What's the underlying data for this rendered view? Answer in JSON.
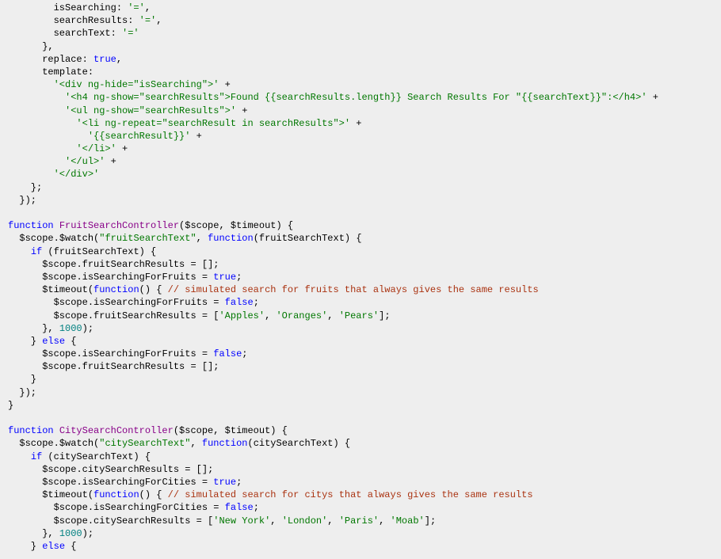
{
  "code": {
    "lines": [
      [
        [
          "        ",
          "punct"
        ],
        [
          "isSearching",
          "propkey"
        ],
        [
          ":",
          "punct"
        ],
        [
          " ",
          "default"
        ],
        [
          "'='",
          "string"
        ],
        [
          ",",
          "punct"
        ]
      ],
      [
        [
          "        ",
          "punct"
        ],
        [
          "searchResults",
          "propkey"
        ],
        [
          ":",
          "punct"
        ],
        [
          " ",
          "default"
        ],
        [
          "'='",
          "string"
        ],
        [
          ",",
          "punct"
        ]
      ],
      [
        [
          "        ",
          "punct"
        ],
        [
          "searchText",
          "propkey"
        ],
        [
          ":",
          "punct"
        ],
        [
          " ",
          "default"
        ],
        [
          "'='",
          "string"
        ]
      ],
      [
        [
          "      },",
          "punct"
        ]
      ],
      [
        [
          "      ",
          "punct"
        ],
        [
          "replace",
          "propkey"
        ],
        [
          ":",
          "punct"
        ],
        [
          " ",
          "default"
        ],
        [
          "true",
          "bool"
        ],
        [
          ",",
          "punct"
        ]
      ],
      [
        [
          "      ",
          "punct"
        ],
        [
          "template",
          "propkey"
        ],
        [
          ":",
          "punct"
        ]
      ],
      [
        [
          "        ",
          "punct"
        ],
        [
          "'<div ng-hide=\"isSearching\">'",
          "string"
        ],
        [
          " + ",
          "op"
        ]
      ],
      [
        [
          "          ",
          "punct"
        ],
        [
          "'<h4 ng-show=\"searchResults\">Found {{searchResults.length}} Search Results For \"{{searchText}}\":</h4>'",
          "string"
        ],
        [
          " + ",
          "op"
        ]
      ],
      [
        [
          "          ",
          "punct"
        ],
        [
          "'<ul ng-show=\"searchResults\">'",
          "string"
        ],
        [
          " + ",
          "op"
        ]
      ],
      [
        [
          "            ",
          "punct"
        ],
        [
          "'<li ng-repeat=\"searchResult in searchResults\">'",
          "string"
        ],
        [
          " + ",
          "op"
        ]
      ],
      [
        [
          "              ",
          "punct"
        ],
        [
          "'{{searchResult}}'",
          "string"
        ],
        [
          " + ",
          "op"
        ]
      ],
      [
        [
          "            ",
          "punct"
        ],
        [
          "'</li>'",
          "string"
        ],
        [
          " + ",
          "op"
        ]
      ],
      [
        [
          "          ",
          "punct"
        ],
        [
          "'</ul>'",
          "string"
        ],
        [
          " + ",
          "op"
        ]
      ],
      [
        [
          "        ",
          "punct"
        ],
        [
          "'</div>'",
          "string"
        ]
      ],
      [
        [
          "    };",
          "punct"
        ]
      ],
      [
        [
          "  });",
          "punct"
        ]
      ],
      [
        [
          "",
          "default"
        ]
      ],
      [
        [
          "function",
          "kw"
        ],
        [
          " ",
          "default"
        ],
        [
          "FruitSearchController",
          "func"
        ],
        [
          "(",
          "punct"
        ],
        [
          "$scope",
          "var"
        ],
        [
          ", ",
          "punct"
        ],
        [
          "$timeout",
          "var"
        ],
        [
          ") {",
          "punct"
        ]
      ],
      [
        [
          "  ",
          "punct"
        ],
        [
          "$scope",
          "var"
        ],
        [
          ".",
          "punct"
        ],
        [
          "$watch",
          "var"
        ],
        [
          "(",
          "punct"
        ],
        [
          "\"fruitSearchText\"",
          "string"
        ],
        [
          ", ",
          "punct"
        ],
        [
          "function",
          "kw"
        ],
        [
          "(",
          "punct"
        ],
        [
          "fruitSearchText",
          "var"
        ],
        [
          ") {",
          "punct"
        ]
      ],
      [
        [
          "    ",
          "punct"
        ],
        [
          "if",
          "kw"
        ],
        [
          " (",
          "punct"
        ],
        [
          "fruitSearchText",
          "var"
        ],
        [
          ") {",
          "punct"
        ]
      ],
      [
        [
          "      ",
          "punct"
        ],
        [
          "$scope",
          "var"
        ],
        [
          ".",
          "punct"
        ],
        [
          "fruitSearchResults",
          "var"
        ],
        [
          " = [];",
          "punct"
        ]
      ],
      [
        [
          "      ",
          "punct"
        ],
        [
          "$scope",
          "var"
        ],
        [
          ".",
          "punct"
        ],
        [
          "isSearchingForFruits",
          "var"
        ],
        [
          " = ",
          "op"
        ],
        [
          "true",
          "bool"
        ],
        [
          ";",
          "punct"
        ]
      ],
      [
        [
          "      ",
          "punct"
        ],
        [
          "$timeout",
          "var"
        ],
        [
          "(",
          "punct"
        ],
        [
          "function",
          "kw"
        ],
        [
          "() { ",
          "punct"
        ],
        [
          "// simulated search for fruits that always gives the same results",
          "comment"
        ]
      ],
      [
        [
          "        ",
          "punct"
        ],
        [
          "$scope",
          "var"
        ],
        [
          ".",
          "punct"
        ],
        [
          "isSearchingForFruits",
          "var"
        ],
        [
          " = ",
          "op"
        ],
        [
          "false",
          "bool"
        ],
        [
          ";",
          "punct"
        ]
      ],
      [
        [
          "        ",
          "punct"
        ],
        [
          "$scope",
          "var"
        ],
        [
          ".",
          "punct"
        ],
        [
          "fruitSearchResults",
          "var"
        ],
        [
          " = [",
          "punct"
        ],
        [
          "'Apples'",
          "string"
        ],
        [
          ", ",
          "punct"
        ],
        [
          "'Oranges'",
          "string"
        ],
        [
          ", ",
          "punct"
        ],
        [
          "'Pears'",
          "string"
        ],
        [
          "];",
          "punct"
        ]
      ],
      [
        [
          "      }, ",
          "punct"
        ],
        [
          "1000",
          "number"
        ],
        [
          ");",
          "punct"
        ]
      ],
      [
        [
          "    } ",
          "punct"
        ],
        [
          "else",
          "kw"
        ],
        [
          " {",
          "punct"
        ]
      ],
      [
        [
          "      ",
          "punct"
        ],
        [
          "$scope",
          "var"
        ],
        [
          ".",
          "punct"
        ],
        [
          "isSearchingForFruits",
          "var"
        ],
        [
          " = ",
          "op"
        ],
        [
          "false",
          "bool"
        ],
        [
          ";",
          "punct"
        ]
      ],
      [
        [
          "      ",
          "punct"
        ],
        [
          "$scope",
          "var"
        ],
        [
          ".",
          "punct"
        ],
        [
          "fruitSearchResults",
          "var"
        ],
        [
          " = [];",
          "punct"
        ]
      ],
      [
        [
          "    }",
          "punct"
        ]
      ],
      [
        [
          "  });",
          "punct"
        ]
      ],
      [
        [
          "}",
          "punct"
        ]
      ],
      [
        [
          "",
          "default"
        ]
      ],
      [
        [
          "function",
          "kw"
        ],
        [
          " ",
          "default"
        ],
        [
          "CitySearchController",
          "func"
        ],
        [
          "(",
          "punct"
        ],
        [
          "$scope",
          "var"
        ],
        [
          ", ",
          "punct"
        ],
        [
          "$timeout",
          "var"
        ],
        [
          ") {",
          "punct"
        ]
      ],
      [
        [
          "  ",
          "punct"
        ],
        [
          "$scope",
          "var"
        ],
        [
          ".",
          "punct"
        ],
        [
          "$watch",
          "var"
        ],
        [
          "(",
          "punct"
        ],
        [
          "\"citySearchText\"",
          "string"
        ],
        [
          ", ",
          "punct"
        ],
        [
          "function",
          "kw"
        ],
        [
          "(",
          "punct"
        ],
        [
          "citySearchText",
          "var"
        ],
        [
          ") {",
          "punct"
        ]
      ],
      [
        [
          "    ",
          "punct"
        ],
        [
          "if",
          "kw"
        ],
        [
          " (",
          "punct"
        ],
        [
          "citySearchText",
          "var"
        ],
        [
          ") {",
          "punct"
        ]
      ],
      [
        [
          "      ",
          "punct"
        ],
        [
          "$scope",
          "var"
        ],
        [
          ".",
          "punct"
        ],
        [
          "citySearchResults",
          "var"
        ],
        [
          " = [];",
          "punct"
        ]
      ],
      [
        [
          "      ",
          "punct"
        ],
        [
          "$scope",
          "var"
        ],
        [
          ".",
          "punct"
        ],
        [
          "isSearchingForCities",
          "var"
        ],
        [
          " = ",
          "op"
        ],
        [
          "true",
          "bool"
        ],
        [
          ";",
          "punct"
        ]
      ],
      [
        [
          "      ",
          "punct"
        ],
        [
          "$timeout",
          "var"
        ],
        [
          "(",
          "punct"
        ],
        [
          "function",
          "kw"
        ],
        [
          "() { ",
          "punct"
        ],
        [
          "// simulated search for citys that always gives the same results",
          "comment"
        ]
      ],
      [
        [
          "        ",
          "punct"
        ],
        [
          "$scope",
          "var"
        ],
        [
          ".",
          "punct"
        ],
        [
          "isSearchingForCities",
          "var"
        ],
        [
          " = ",
          "op"
        ],
        [
          "false",
          "bool"
        ],
        [
          ";",
          "punct"
        ]
      ],
      [
        [
          "        ",
          "punct"
        ],
        [
          "$scope",
          "var"
        ],
        [
          ".",
          "punct"
        ],
        [
          "citySearchResults",
          "var"
        ],
        [
          " = [",
          "punct"
        ],
        [
          "'New York'",
          "string"
        ],
        [
          ", ",
          "punct"
        ],
        [
          "'London'",
          "string"
        ],
        [
          ", ",
          "punct"
        ],
        [
          "'Paris'",
          "string"
        ],
        [
          ", ",
          "punct"
        ],
        [
          "'Moab'",
          "string"
        ],
        [
          "];",
          "punct"
        ]
      ],
      [
        [
          "      }, ",
          "punct"
        ],
        [
          "1000",
          "number"
        ],
        [
          ");",
          "punct"
        ]
      ],
      [
        [
          "    } ",
          "punct"
        ],
        [
          "else",
          "kw"
        ],
        [
          " {",
          "punct"
        ]
      ]
    ]
  }
}
